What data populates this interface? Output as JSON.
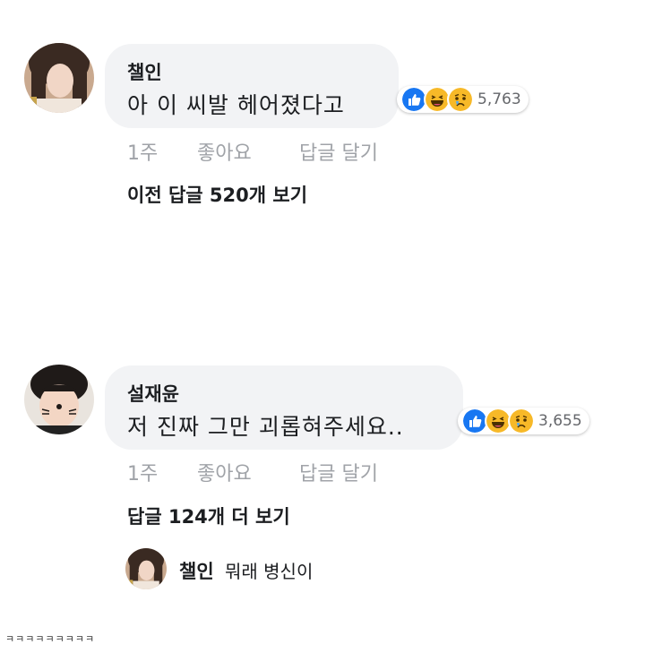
{
  "comments": [
    {
      "author": "챌인",
      "text": "아 이 씨발 헤어졌다고",
      "reaction_count": "5,763",
      "time": "1주",
      "like_label": "좋아요",
      "reply_label": "답글 달기",
      "more_replies": "이전 답글 520개 보기"
    },
    {
      "author": "설재윤",
      "text": "저 진짜 그만 괴롭혀주세요..",
      "reaction_count": "3,655",
      "time": "1주",
      "like_label": "좋아요",
      "reply_label": "답글 달기",
      "more_replies": "답글 124개 더 보기"
    }
  ],
  "reply": {
    "author": "챌인",
    "text": "뭐래 병신이"
  },
  "footer_text": "ㅋㅋㅋㅋㅋㅋㅋㅋㅋ",
  "colors": {
    "bubble": "#f2f3f5",
    "like_blue": "#1877f2",
    "emoji_yellow": "#f7b928",
    "muted": "#a0a3a8"
  },
  "icons": [
    "like-reaction-icon",
    "haha-reaction-icon",
    "sad-reaction-icon"
  ]
}
